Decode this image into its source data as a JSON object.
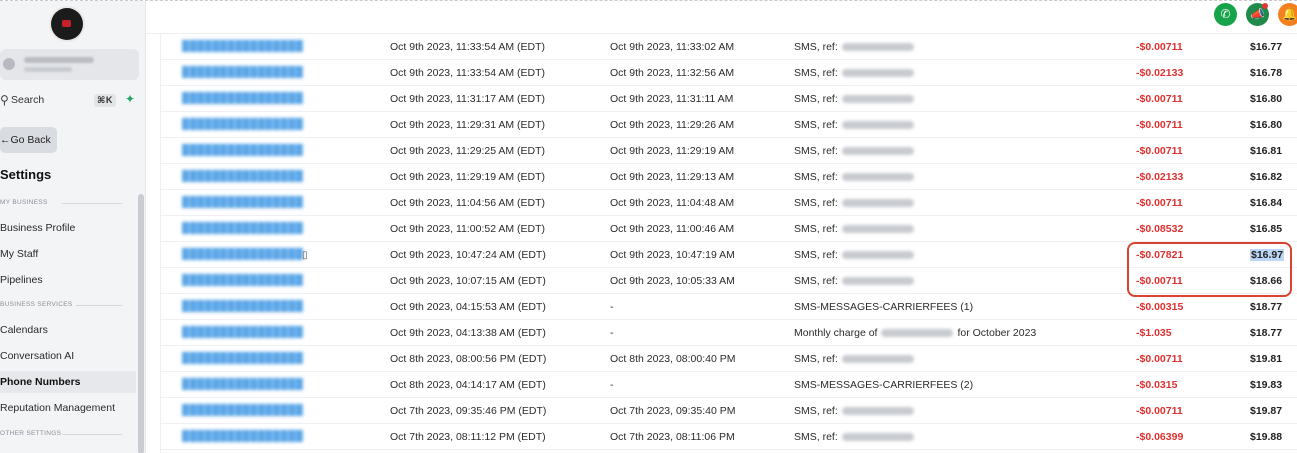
{
  "sidebar": {
    "search_label": "Search",
    "search_shortcut": "⌘K",
    "go_back": "Go Back",
    "settings_title": "Settings",
    "section_my_business": "MY BUSINESS",
    "section_business_services": "BUSINESS SERVICES",
    "section_other_settings": "OTHER SETTINGS",
    "items": {
      "business_profile": "Business Profile",
      "my_staff": "My Staff",
      "pipelines": "Pipelines",
      "calendars": "Calendars",
      "conversation_ai": "Conversation AI",
      "phone_numbers": "Phone Numbers",
      "reputation_management": "Reputation Management"
    }
  },
  "topbar": {
    "icons": [
      "phone-icon",
      "megaphone-icon",
      "bell-icon"
    ],
    "colors": {
      "phone": "#17a34a",
      "megaphone": "#1f8a4a",
      "bell": "#f3801f"
    }
  },
  "table": {
    "rows": [
      {
        "created": "Oct 9th 2023, 11:33:54 AM (EDT)",
        "sent": "Oct 9th 2023, 11:33:02 AM",
        "desc": "SMS, ref:",
        "amount": "-$0.00711",
        "balance": "$16.77"
      },
      {
        "created": "Oct 9th 2023, 11:33:54 AM (EDT)",
        "sent": "Oct 9th 2023, 11:32:56 AM",
        "desc": "SMS, ref:",
        "amount": "-$0.02133",
        "balance": "$16.78"
      },
      {
        "created": "Oct 9th 2023, 11:31:17 AM (EDT)",
        "sent": "Oct 9th 2023, 11:31:11 AM",
        "desc": "SMS, ref:",
        "amount": "-$0.00711",
        "balance": "$16.80"
      },
      {
        "created": "Oct 9th 2023, 11:29:31 AM (EDT)",
        "sent": "Oct 9th 2023, 11:29:26 AM",
        "desc": "SMS, ref:",
        "amount": "-$0.00711",
        "balance": "$16.80"
      },
      {
        "created": "Oct 9th 2023, 11:29:25 AM (EDT)",
        "sent": "Oct 9th 2023, 11:29:19 AM",
        "desc": "SMS, ref:",
        "amount": "-$0.00711",
        "balance": "$16.81"
      },
      {
        "created": "Oct 9th 2023, 11:29:19 AM (EDT)",
        "sent": "Oct 9th 2023, 11:29:13 AM",
        "desc": "SMS, ref:",
        "amount": "-$0.02133",
        "balance": "$16.82"
      },
      {
        "created": "Oct 9th 2023, 11:04:56 AM (EDT)",
        "sent": "Oct 9th 2023, 11:04:48 AM",
        "desc": "SMS, ref:",
        "amount": "-$0.00711",
        "balance": "$16.84"
      },
      {
        "created": "Oct 9th 2023, 11:00:52 AM (EDT)",
        "sent": "Oct 9th 2023, 11:00:46 AM",
        "desc": "SMS, ref:",
        "amount": "-$0.08532",
        "balance": "$16.85"
      },
      {
        "created": "Oct 9th 2023, 10:47:24 AM (EDT)",
        "sent": "Oct 9th 2023, 10:47:19 AM",
        "desc": "SMS, ref:",
        "amount": "-$0.07821",
        "balance": "$16.97",
        "selected": true
      },
      {
        "created": "Oct 9th 2023, 10:07:15 AM (EDT)",
        "sent": "Oct 9th 2023, 10:05:33 AM",
        "desc": "SMS, ref:",
        "amount": "-$0.00711",
        "balance": "$18.66"
      },
      {
        "created": "Oct 9th 2023, 04:15:53 AM (EDT)",
        "sent": "-",
        "desc": "SMS-MESSAGES-CARRIERFEES (1)",
        "amount": "-$0.00315",
        "balance": "$18.77"
      },
      {
        "created": "Oct 9th 2023, 04:13:38 AM (EDT)",
        "sent": "-",
        "desc": "Monthly charge of",
        "desc_suffix": "for October 2023",
        "amount": "-$1.035",
        "balance": "$18.77"
      },
      {
        "created": "Oct 8th 2023, 08:00:56 PM (EDT)",
        "sent": "Oct 8th 2023, 08:00:40 PM",
        "desc": "SMS, ref:",
        "amount": "-$0.00711",
        "balance": "$19.81"
      },
      {
        "created": "Oct 8th 2023, 04:14:17 AM (EDT)",
        "sent": "-",
        "desc": "SMS-MESSAGES-CARRIERFEES (2)",
        "amount": "-$0.0315",
        "balance": "$19.83"
      },
      {
        "created": "Oct 7th 2023, 09:35:46 PM (EDT)",
        "sent": "Oct 7th 2023, 09:35:40 PM",
        "desc": "SMS, ref:",
        "amount": "-$0.00711",
        "balance": "$19.87"
      },
      {
        "created": "Oct 7th 2023, 08:11:12 PM (EDT)",
        "sent": "Oct 7th 2023, 08:11:06 PM",
        "desc": "SMS, ref:",
        "amount": "-$0.06399",
        "balance": "$19.88"
      }
    ],
    "colors": {
      "amount": "#e03131",
      "id_link": "#5aa6e8",
      "highlight_box": "#d9432f"
    }
  }
}
